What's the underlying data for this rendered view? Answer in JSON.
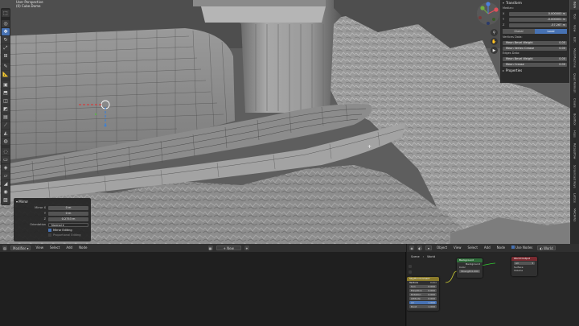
{
  "viewport": {
    "mode": "User Perspective",
    "object": "(0) Cube.Dome",
    "tools": [
      {
        "name": "select-box-icon",
        "glyph": "⬚",
        "active": false
      },
      {
        "name": "cursor-icon",
        "glyph": "◎",
        "active": false
      },
      {
        "name": "move-icon",
        "glyph": "✥",
        "active": true
      },
      {
        "name": "rotate-icon",
        "glyph": "↻",
        "active": false
      },
      {
        "name": "scale-icon",
        "glyph": "⤢",
        "active": false
      },
      {
        "name": "transform-icon",
        "glyph": "⊞",
        "active": false
      },
      {
        "name": "annotate-icon",
        "glyph": "✎",
        "active": false
      },
      {
        "name": "measure-icon",
        "glyph": "📐",
        "active": false
      },
      {
        "name": "add-cube-icon",
        "glyph": "▣",
        "active": false
      },
      {
        "name": "extrude-icon",
        "glyph": "⬒",
        "active": false
      },
      {
        "name": "inset-icon",
        "glyph": "◫",
        "active": false
      },
      {
        "name": "bevel-icon",
        "glyph": "◩",
        "active": false
      },
      {
        "name": "loop-cut-icon",
        "glyph": "▤",
        "active": false
      },
      {
        "name": "knife-icon",
        "glyph": "⟋",
        "active": false
      },
      {
        "name": "poly-build-icon",
        "glyph": "◭",
        "active": false
      },
      {
        "name": "spin-icon",
        "glyph": "◍",
        "active": false
      },
      {
        "name": "smooth-icon",
        "glyph": "◌",
        "active": false
      },
      {
        "name": "edge-slide-icon",
        "glyph": "▭",
        "active": false
      },
      {
        "name": "shrink-fatten-icon",
        "glyph": "◈",
        "active": false
      },
      {
        "name": "shear-icon",
        "glyph": "▱",
        "active": false
      },
      {
        "name": "rip-icon",
        "glyph": "◢",
        "active": false
      },
      {
        "name": "select-circle-icon",
        "glyph": "◉",
        "active": false
      },
      {
        "name": "image-icon",
        "glyph": "▨",
        "active": false
      }
    ],
    "gizmo": {
      "x_label": "X",
      "y_label": "Y",
      "z_label": "Z"
    }
  },
  "npanel": {
    "transform_title": "Transform",
    "median_label": "Median:",
    "median": [
      {
        "axis": "X",
        "value": "0.000000 m"
      },
      {
        "axis": "Y",
        "value": "-0.000001 m"
      },
      {
        "axis": "Z",
        "value": "-57.267 m"
      }
    ],
    "toggle_global": "Global",
    "toggle_local": "Local",
    "vertex_data_label": "Vertices Data:",
    "vertex_rows": [
      {
        "label": "Mean Bevel Weight",
        "value": "0.00"
      },
      {
        "label": "Mean Vertex Crease",
        "value": "0.00"
      }
    ],
    "edge_data_label": "Edges Data:",
    "edge_rows": [
      {
        "label": "Mean Bevel Weight",
        "value": "0.00"
      },
      {
        "label": "Mean Crease",
        "value": "0.00"
      }
    ],
    "properties_title": "Properties"
  },
  "vtabs": [
    "Item",
    "Tool",
    "View",
    "Edit",
    "MeshMachine",
    "Quad Remesh",
    "Create",
    "BoolTool",
    "Hops",
    "Retopoflow",
    "Screencast Keys",
    "Lattice",
    "MACHIN3"
  ],
  "operator_panel": {
    "title": "Mirror",
    "fields": [
      {
        "label": "Mirror X",
        "value": "0 m"
      },
      {
        "label": "Y",
        "value": "0 m"
      },
      {
        "label": "Z",
        "value": "0.2753 m"
      }
    ],
    "orientation_label": "Orientation",
    "orientation_value": "Normal",
    "mirror_editing": "Mirror Editing",
    "proportional_editing": "Proportional Editing"
  },
  "image_editor": {
    "mode": "Modifier",
    "menus": [
      "View",
      "Select",
      "Add",
      "Node"
    ],
    "new_label": "New"
  },
  "node_editor": {
    "header": [
      "Object",
      "View",
      "Select",
      "Add",
      "Node"
    ],
    "world_dropdown": "World",
    "use_nodes": "Use Nodes",
    "breadcrumb": [
      "Scene",
      "World"
    ],
    "nodes": {
      "background": {
        "title": "Background",
        "output": "Background",
        "color": "Color",
        "strength_label": "Strength",
        "strength": "0.000"
      },
      "world_output": {
        "title": "World Output",
        "target": "All",
        "surface": "Surface",
        "volume": "Volume"
      },
      "texture": {
        "title": "Sky/Environment Texture",
        "output": "Color",
        "rows": [
          {
            "label": "Sun",
            "value": "0.000"
          },
          {
            "label": "Elevation",
            "value": "0.000"
          },
          {
            "label": "Rotation",
            "value": "0.000"
          },
          {
            "label": "Altitude",
            "value": "0.000"
          },
          {
            "label": "Air",
            "value": "1.000"
          },
          {
            "label": "Dust",
            "value": "1.000"
          }
        ]
      }
    }
  },
  "colors": {
    "accent": "#4772b3",
    "node_green": "#2f6b3a",
    "node_red": "#7a2a30",
    "node_yellow": "#8a7a2a"
  }
}
